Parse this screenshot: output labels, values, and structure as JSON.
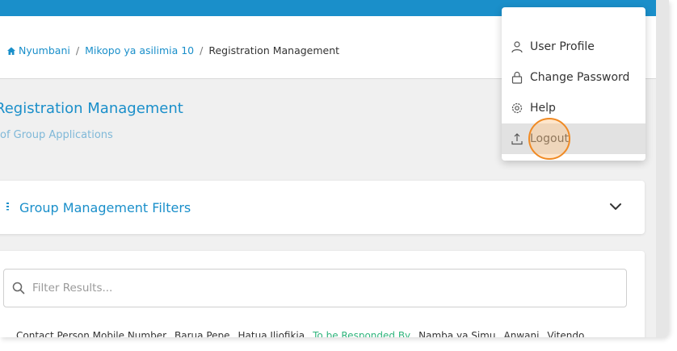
{
  "breadcrumb": {
    "items": [
      "Nyumbani",
      "Mikopo ya asilimia 10",
      "Registration Management"
    ],
    "separator": "/"
  },
  "page": {
    "title": "Registration Management",
    "subtitle": "of Group Applications"
  },
  "filters": {
    "label": "Group Management Filters"
  },
  "search": {
    "placeholder": "Filter Results...",
    "value": ""
  },
  "table": {
    "columns": [
      "Contact Person Mobile Number",
      "Barua Pepe",
      "Hatua Iliofikia",
      "To be Responded By",
      "Namba ya Simu",
      "Anwani",
      "Vitendo"
    ]
  },
  "user_menu": {
    "items": [
      {
        "label": "User Profile",
        "icon": "user-icon"
      },
      {
        "label": "Change Password",
        "icon": "lock-icon"
      },
      {
        "label": "Help",
        "icon": "gear-icon"
      },
      {
        "label": "Logout",
        "icon": "upload-icon"
      }
    ]
  },
  "colors": {
    "brand": "#1a8fca",
    "accent_green": "#2fb47c",
    "click_highlight": "#f08a24"
  }
}
